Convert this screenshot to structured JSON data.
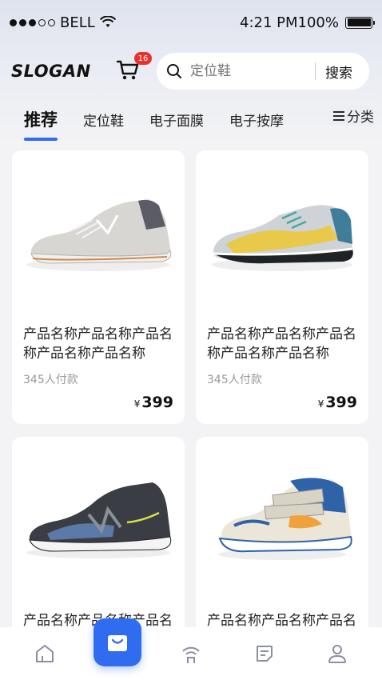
{
  "status_bar": {
    "carrier": "BELL",
    "time": "4:21 PM",
    "battery": "100%"
  },
  "header": {
    "logo": "SLOGAN",
    "cart_count": "16"
  },
  "search": {
    "placeholder": "定位鞋",
    "button_label": "搜索"
  },
  "tabs": [
    {
      "label": "推荐",
      "active": true
    },
    {
      "label": "定位鞋"
    },
    {
      "label": "电子面膜"
    },
    {
      "label": "电子按摩"
    }
  ],
  "tab_more": {
    "label": "分类",
    "icon": "menu-icon"
  },
  "products": [
    {
      "title": "产品名称产品名称产品名称产品名称产品名称",
      "sold": "345人付款",
      "currency": "¥",
      "price": "399",
      "image": "grey-sneaker"
    },
    {
      "title": "产品名称产品名称产品名称产品名称产品名称",
      "sold": "345人付款",
      "currency": "¥",
      "price": "399",
      "image": "colorful-sneaker"
    },
    {
      "title": "产品名称产品名称产品名称产品名称产品名称",
      "sold": "",
      "currency": "",
      "price": "",
      "image": "navy-sneaker"
    },
    {
      "title": "产品名称产品名称产品名称产品名称产品名称",
      "sold": "",
      "currency": "",
      "price": "",
      "image": "kids-sneaker"
    }
  ],
  "bottom_nav": [
    {
      "icon": "home-icon"
    },
    {
      "icon": "bag-icon",
      "active": true
    },
    {
      "icon": "signal-icon"
    },
    {
      "icon": "document-icon"
    },
    {
      "icon": "user-icon"
    }
  ],
  "colors": {
    "accent": "#2f6cf0",
    "badge": "#e8332c"
  }
}
